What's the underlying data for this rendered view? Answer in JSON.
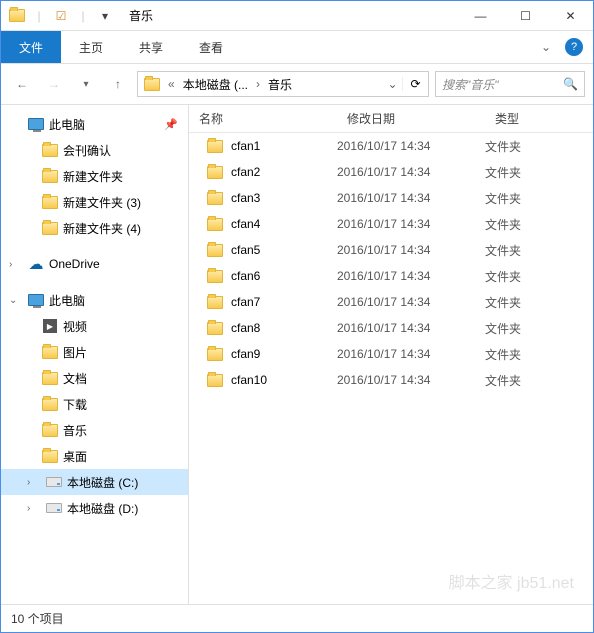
{
  "window": {
    "title": "音乐"
  },
  "ribbon": {
    "file": "文件",
    "tabs": [
      "主页",
      "共享",
      "查看"
    ]
  },
  "address": {
    "seg1": "本地磁盘 (...",
    "seg2": "音乐"
  },
  "search": {
    "placeholder": "搜索\"音乐\""
  },
  "sidebar": {
    "quick": {
      "label": "此电脑"
    },
    "quick_items": [
      {
        "label": "会刊确认"
      },
      {
        "label": "新建文件夹"
      },
      {
        "label": "新建文件夹 (3)"
      },
      {
        "label": "新建文件夹 (4)"
      }
    ],
    "onedrive": "OneDrive",
    "thispc": "此电脑",
    "thispc_items": [
      {
        "label": "视频",
        "icon": "video"
      },
      {
        "label": "图片",
        "icon": "folder"
      },
      {
        "label": "文档",
        "icon": "folder"
      },
      {
        "label": "下载",
        "icon": "folder"
      },
      {
        "label": "音乐",
        "icon": "folder"
      },
      {
        "label": "桌面",
        "icon": "folder"
      },
      {
        "label": "本地磁盘 (C:)",
        "icon": "drive",
        "selected": true
      },
      {
        "label": "本地磁盘 (D:)",
        "icon": "drive"
      }
    ]
  },
  "columns": {
    "name": "名称",
    "date": "修改日期",
    "type": "类型"
  },
  "files": [
    {
      "name": "cfan1",
      "date": "2016/10/17 14:34",
      "type": "文件夹"
    },
    {
      "name": "cfan2",
      "date": "2016/10/17 14:34",
      "type": "文件夹"
    },
    {
      "name": "cfan3",
      "date": "2016/10/17 14:34",
      "type": "文件夹"
    },
    {
      "name": "cfan4",
      "date": "2016/10/17 14:34",
      "type": "文件夹"
    },
    {
      "name": "cfan5",
      "date": "2016/10/17 14:34",
      "type": "文件夹"
    },
    {
      "name": "cfan6",
      "date": "2016/10/17 14:34",
      "type": "文件夹"
    },
    {
      "name": "cfan7",
      "date": "2016/10/17 14:34",
      "type": "文件夹"
    },
    {
      "name": "cfan8",
      "date": "2016/10/17 14:34",
      "type": "文件夹"
    },
    {
      "name": "cfan9",
      "date": "2016/10/17 14:34",
      "type": "文件夹"
    },
    {
      "name": "cfan10",
      "date": "2016/10/17 14:34",
      "type": "文件夹"
    }
  ],
  "status": {
    "count": "10 个项目"
  },
  "watermark": "脚本之家 jb51.net"
}
